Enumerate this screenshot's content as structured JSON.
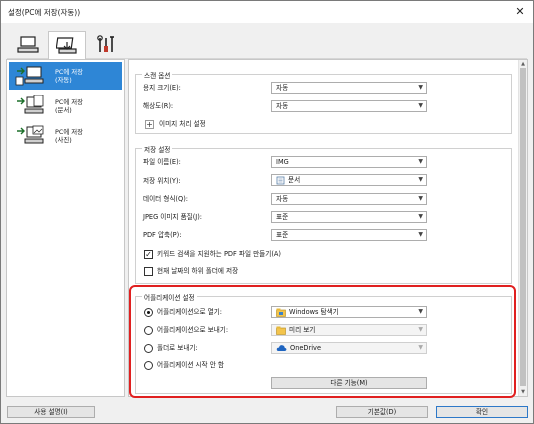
{
  "window": {
    "title": "설정(PC에 저장(자동))"
  },
  "tabs": [
    {
      "icon": "computer-scan-icon",
      "active": false
    },
    {
      "icon": "save-to-pc-icon",
      "active": true
    },
    {
      "icon": "tools-icon",
      "active": false
    }
  ],
  "left_items": [
    {
      "line1": "PC에 저장",
      "line2": "(자동)",
      "selected": true
    },
    {
      "line1": "PC에 저장",
      "line2": "(문서)",
      "selected": false
    },
    {
      "line1": "PC에 저장",
      "line2": "(사진)",
      "selected": false
    }
  ],
  "scan_options": {
    "legend": "스캔 옵션",
    "paper_size_label": "용지 크기(E):",
    "paper_size_value": "자동",
    "resolution_label": "해상도(R):",
    "resolution_value": "자동",
    "image_processing_label": "이미지 처리 설정"
  },
  "save_settings": {
    "legend": "저장 설정",
    "file_name_label": "파일 이름(E):",
    "file_name_value": "IMG",
    "save_in_label": "저장 위치(Y):",
    "save_in_value": "문서",
    "data_format_label": "데이터 형식(Q):",
    "data_format_value": "자동",
    "jpeg_quality_label": "JPEG 이미지 품질(J):",
    "jpeg_quality_value": "표준",
    "pdf_compression_label": "PDF 압축(P):",
    "pdf_compression_value": "표준",
    "searchable_pdf_label": "키워드 검색을 지원하는 PDF 파일 만들기(A)",
    "searchable_pdf_checked": true,
    "subfolder_label": "현재 날짜의 하위 폴더에 저장",
    "subfolder_checked": false
  },
  "app_settings": {
    "legend": "어플리케이션 설정",
    "open_app_label": "어플리케이션으로 열기:",
    "open_app_value": "Windows 탐색기",
    "send_app_label": "어플리케이션으로 보내기:",
    "send_app_value": "미리 보기",
    "send_folder_label": "폴더로 보내기:",
    "send_folder_value": "OneDrive",
    "no_app_label": "어플리케이션 시작 안 함",
    "more_functions_label": "다른 기능(M)",
    "selected_option": "open_app"
  },
  "footer": {
    "instructions_label": "사용 설명(I)",
    "defaults_label": "기본값(D)",
    "ok_label": "확인"
  },
  "colors": {
    "selection": "#2e86d6",
    "highlight_border": "#e02020"
  }
}
